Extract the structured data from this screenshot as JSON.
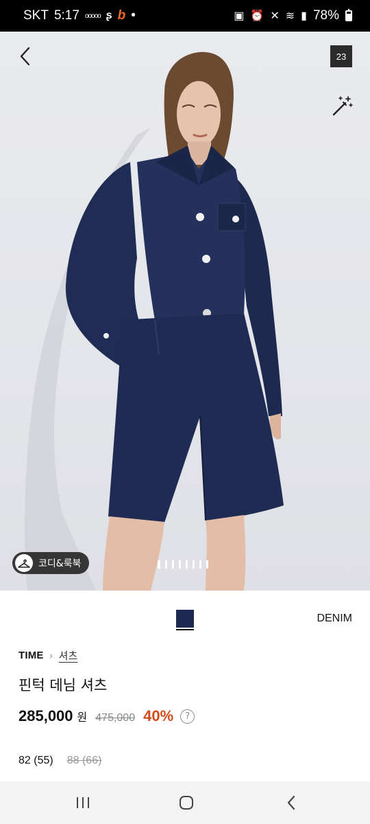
{
  "status_bar": {
    "carrier": "SKT",
    "time": "5:17",
    "battery": "78%"
  },
  "gallery": {
    "photo_count": "23",
    "codi_label": "코디&룩북",
    "pages": 8,
    "active_page": 1
  },
  "product": {
    "color_name": "DENIM",
    "swatch_color": "#1c2a52",
    "brand": "TIME",
    "category": "셔츠",
    "name": "핀턱 데님 셔츠",
    "price": "285,000",
    "currency": "원",
    "original_price": "475,000",
    "discount": "40%",
    "help_symbol": "?",
    "sizes": [
      {
        "label": "82 (55)",
        "sold_out": false
      },
      {
        "label": "88 (66)",
        "sold_out": true
      }
    ]
  },
  "icons": {
    "back": "chevron-left-icon",
    "wand": "magic-wand-icon",
    "hanger": "hanger-icon",
    "recent": "recent-apps-icon",
    "home": "home-icon",
    "nav_back": "nav-back-icon"
  },
  "colors": {
    "accent_discount": "#d24a1c",
    "denim": "#1c2a52"
  }
}
